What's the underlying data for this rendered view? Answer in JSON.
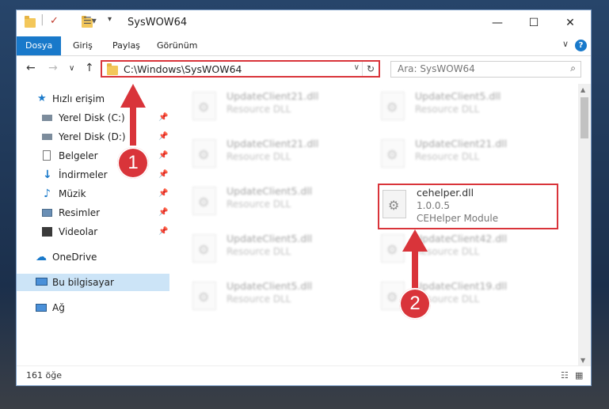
{
  "window": {
    "title": "SysWOW64",
    "controls": {
      "minimize": "—",
      "maximize": "☐",
      "close": "✕"
    }
  },
  "ribbon": {
    "tabs": [
      {
        "label": "Dosya",
        "active": true
      },
      {
        "label": "Giriş"
      },
      {
        "label": "Paylaş"
      },
      {
        "label": "Görünüm"
      }
    ]
  },
  "navigation": {
    "address": "C:\\Windows\\SysWOW64",
    "search_placeholder": "Ara: SysWOW64"
  },
  "sidebar": {
    "quick_access": "Hızlı erişim",
    "items": [
      {
        "label": "Yerel Disk (C:)",
        "icon": "drive-icon",
        "pinned": true
      },
      {
        "label": "Yerel Disk (D:)",
        "icon": "drive-icon",
        "pinned": true
      },
      {
        "label": "Belgeler",
        "icon": "documents-icon",
        "pinned": true
      },
      {
        "label": "İndirmeler",
        "icon": "downloads-icon",
        "pinned": true
      },
      {
        "label": "Müzik",
        "icon": "music-icon",
        "pinned": true
      },
      {
        "label": "Resimler",
        "icon": "pictures-icon",
        "pinned": true
      },
      {
        "label": "Videolar",
        "icon": "videos-icon",
        "pinned": true
      }
    ],
    "onedrive": "OneDrive",
    "this_pc": "Bu bilgisayar",
    "network": "Ağ"
  },
  "files": [
    {
      "name": "UpdateClient21.dll",
      "desc": "Resource DLL"
    },
    {
      "name": "UpdateClient5.dll",
      "desc": "Resource DLL"
    },
    {
      "name": "UpdateClient21.dll",
      "desc": "Resource DLL"
    },
    {
      "name": "UpdateClient21.dll",
      "desc": "Resource DLL"
    },
    {
      "name": "UpdateClient5.dll",
      "desc": "Resource DLL"
    },
    {
      "name": "cehelper.dll",
      "version": "1.0.0.5",
      "desc": "CEHelper Module"
    },
    {
      "name": "UpdateClient5.dll",
      "desc": "Resource DLL"
    },
    {
      "name": "UpdateClient42.dll",
      "desc": "Resource DLL"
    },
    {
      "name": "UpdateClient5.dll",
      "desc": "Resource DLL"
    },
    {
      "name": "UpdateClient19.dll",
      "desc": "Resource DLL"
    }
  ],
  "status": {
    "count": "161 öğe"
  },
  "annotations": {
    "step1": "1",
    "step2": "2",
    "color": "#d9343a"
  }
}
